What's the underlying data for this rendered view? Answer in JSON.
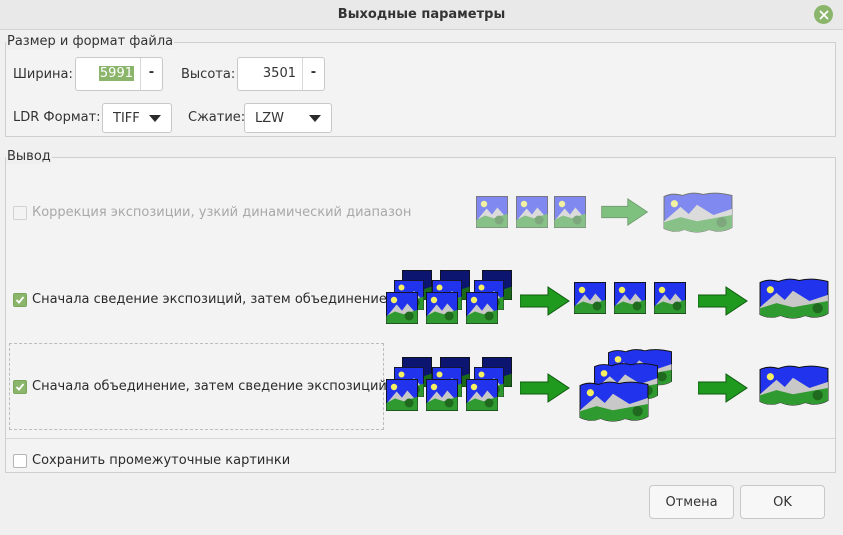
{
  "window": {
    "title": "Выходные параметры"
  },
  "size_format": {
    "group_label": "Размер и формат файла",
    "width_label": "Ширина:",
    "width_value": "5991",
    "height_label": "Высота:",
    "height_value": "3501",
    "stepper_glyph": "-",
    "ldr_format_label": "LDR Формат:",
    "ldr_format_value": "TIFF",
    "compression_label": "Сжатие:",
    "compression_value": "LZW"
  },
  "output": {
    "group_label": "Вывод",
    "options": [
      {
        "label": "Коррекция экспозиции, узкий динамический диапазон",
        "checked": false,
        "enabled": false
      },
      {
        "label": "Сначала сведение экспозиций, затем объединение",
        "checked": true,
        "enabled": true
      },
      {
        "label": "Сначала объединение, затем сведение экспозиций",
        "checked": true,
        "enabled": true
      }
    ],
    "save_intermediate": {
      "label": "Сохранить промежуточные картинки",
      "checked": false
    }
  },
  "buttons": {
    "cancel": "Отмена",
    "ok": "OK"
  },
  "colors": {
    "accent": "#8ab56a",
    "arrow": "#1f9a1f",
    "sky": "#2233ee",
    "grass": "#2f9a2f"
  },
  "icons": [
    "close-icon",
    "checkmark-icon",
    "chevron-down-icon",
    "arrow-right-icon"
  ]
}
